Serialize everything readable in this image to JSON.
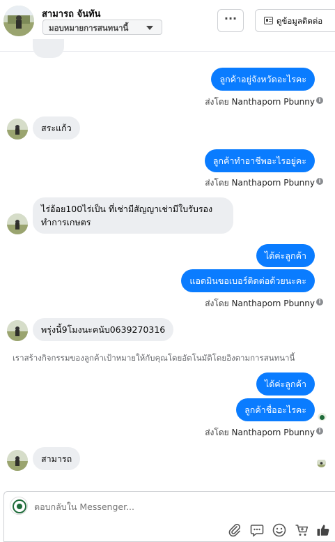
{
  "header": {
    "contact_name": "สามารถ จันทัน",
    "assign_label": "มอบหมายการสนทนานี้",
    "more_label": "···",
    "view_contact_label": "ดูข้อมูลติดต่อ"
  },
  "messages": {
    "m1": "ลูกค้าอยู่จังหวัดอะไรคะ",
    "m2": "สระแก้ว",
    "m3": "ลูกค้าทำอาชีพอะไรอยู่คะ",
    "m4": "ไร่อ้อย100ไร่เป็น ที่เช่ามีสัญญาเช่ามีใบรับรอง ทำการเกษตร",
    "m5": "ได้ค่ะลูกค้า",
    "m6": "แอดมินขอเบอร์ติดต่อด้วยนะคะ",
    "m7": "พรุ่งนี้9โมงนะคนับ0639270316",
    "m8": "ได้ค่ะลูกค้า",
    "m9": "ลูกค้าชื่ออะไรคะ",
    "m10": "สามารถ"
  },
  "sent_by": {
    "prefix": "ส่งโดย",
    "sender": "Nanthaporn Pbunny"
  },
  "system_note": "เราสร้างกิจกรรมของลูกค้าเป้าหมายให้กับคุณโดยอัตโนมัติโดยอิงตามการสนทนานี้",
  "composer": {
    "placeholder": "ตอบกลับใน Messenger..."
  },
  "icons": [
    "card-icon",
    "info-icon",
    "paperclip-icon",
    "saved-reply-icon",
    "emoji-icon",
    "cart-icon",
    "like-icon"
  ],
  "colors": {
    "outgoing_bubble": "#0a7cff",
    "incoming_bubble": "#eceef1",
    "background": "#ffffff"
  }
}
